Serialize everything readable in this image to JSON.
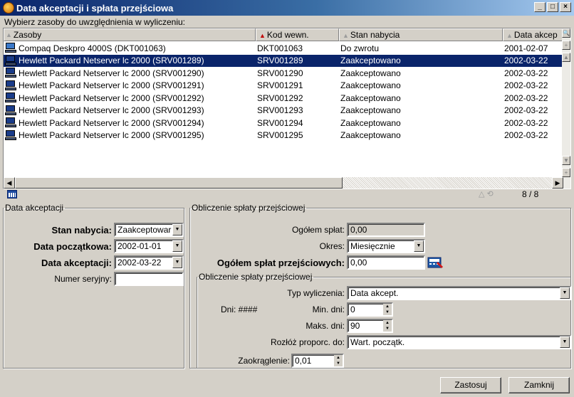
{
  "window": {
    "title": "Data akceptacji i spłata przejściowa",
    "min": "_",
    "max": "□",
    "close": "×"
  },
  "hint": "Wybierz zasoby do uwzględnienia w wyliczeniu:",
  "table": {
    "columns": [
      "Zasoby",
      "Kod wewn.",
      "Stan nabycia",
      "Data akcep"
    ],
    "rows": [
      {
        "name": "Compaq Deskpro 4000S (DKT001063)",
        "code": "DKT001063",
        "status": "Do zwrotu",
        "date": "2001-02-07",
        "icon": "desktop-icon"
      },
      {
        "name": "Hewlett Packard Netserver lc 2000 (SRV001289)",
        "code": "SRV001289",
        "status": "Zaakceptowano",
        "date": "2002-03-22",
        "icon": "server-icon",
        "selected": true
      },
      {
        "name": "Hewlett Packard Netserver lc 2000 (SRV001290)",
        "code": "SRV001290",
        "status": "Zaakceptowano",
        "date": "2002-03-22",
        "icon": "server-icon"
      },
      {
        "name": "Hewlett Packard Netserver lc 2000 (SRV001291)",
        "code": "SRV001291",
        "status": "Zaakceptowano",
        "date": "2002-03-22",
        "icon": "server-icon"
      },
      {
        "name": "Hewlett Packard Netserver lc 2000 (SRV001292)",
        "code": "SRV001292",
        "status": "Zaakceptowano",
        "date": "2002-03-22",
        "icon": "server-icon"
      },
      {
        "name": "Hewlett Packard Netserver lc 2000 (SRV001293)",
        "code": "SRV001293",
        "status": "Zaakceptowano",
        "date": "2002-03-22",
        "icon": "server-icon"
      },
      {
        "name": "Hewlett Packard Netserver lc 2000 (SRV001294)",
        "code": "SRV001294",
        "status": "Zaakceptowano",
        "date": "2002-03-22",
        "icon": "server-icon"
      },
      {
        "name": "Hewlett Packard Netserver lc 2000 (SRV001295)",
        "code": "SRV001295",
        "status": "Zaakceptowano",
        "date": "2002-03-22",
        "icon": "server-icon"
      }
    ],
    "count": "8 / 8"
  },
  "acceptance": {
    "legend": "Data akceptacji",
    "status_label": "Stan nabycia:",
    "status_value": "Zaakceptowar",
    "start_label": "Data początkowa:",
    "start_value": "2002-01-01",
    "accept_label": "Data akceptacji:",
    "accept_value": "2002-03-22",
    "serial_label": "Numer seryjny:",
    "serial_value": ""
  },
  "repayment": {
    "legend": "Obliczenie spłaty przejściowej",
    "total_label": "Ogółem spłat:",
    "total_value": "0,00",
    "period_label": "Okres:",
    "period_value": "Miesięcznie",
    "interim_label": "Ogółem spłat przejściowych:",
    "interim_value": "0,00",
    "inner_legend": "Obliczenie spłaty przejściowej",
    "calc_type_label": "Typ wyliczenia:",
    "calc_type_value": "Data akcept.",
    "days_label": "Dni: ####",
    "min_label": "Min. dni:",
    "min_value": "0",
    "max_label": "Maks. dni:",
    "max_value": "90",
    "spread_label": "Rozłóż proporc. do:",
    "spread_value": "Wart. początk.",
    "round_label": "Zaokrąglenie:",
    "round_value": "0,01"
  },
  "buttons": {
    "apply": "Zastosuj",
    "close": "Zamknij"
  }
}
